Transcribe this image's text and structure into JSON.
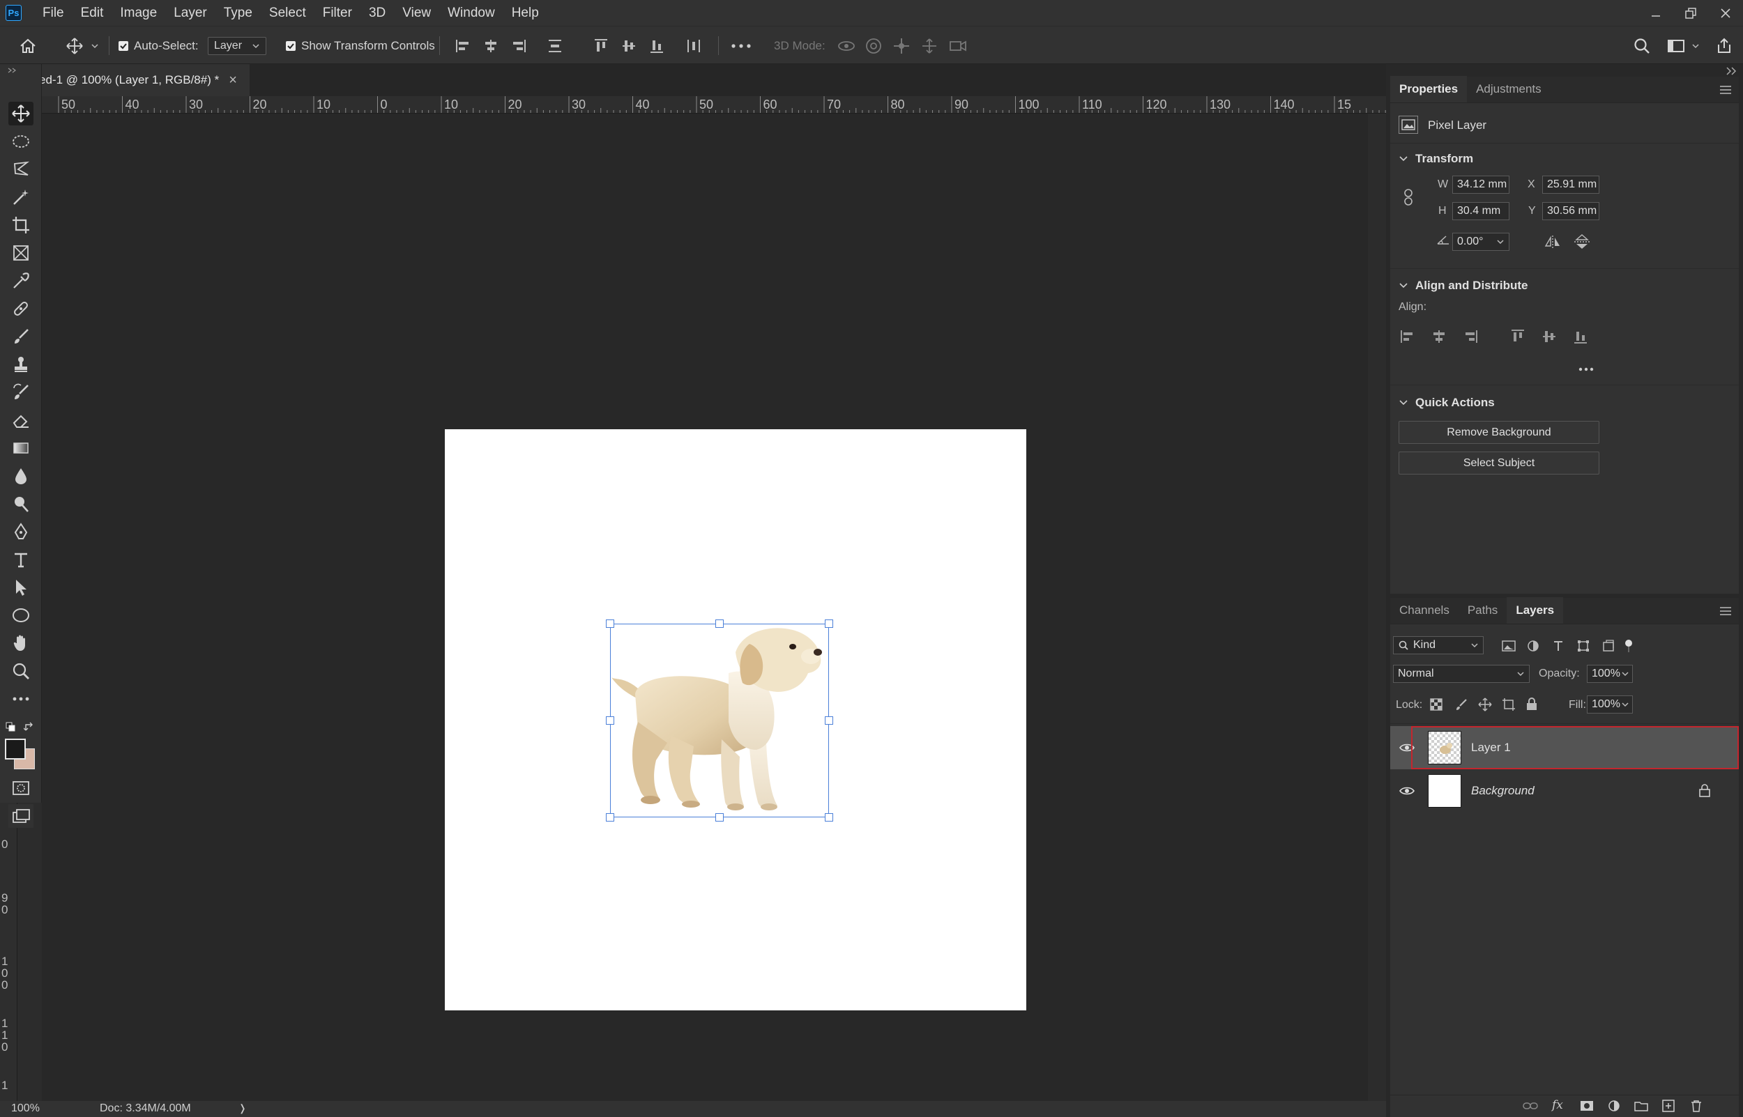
{
  "app": {
    "logo": "Ps"
  },
  "menu": [
    "File",
    "Edit",
    "Image",
    "Layer",
    "Type",
    "Select",
    "Filter",
    "3D",
    "View",
    "Window",
    "Help"
  ],
  "options": {
    "auto_select_label": "Auto-Select:",
    "auto_select_checked": true,
    "auto_select_target": "Layer",
    "show_transform_label": "Show Transform Controls",
    "show_transform_checked": true,
    "mode_3d_label": "3D Mode:"
  },
  "document_tab": {
    "title": "ed-1 @ 100% (Layer 1, RGB/8#) *",
    "close": "×"
  },
  "ruler": {
    "top": [
      "50",
      "40",
      "30",
      "20",
      "10",
      "0",
      "10",
      "20",
      "30",
      "40",
      "50",
      "60",
      "70",
      "80",
      "90",
      "100",
      "110",
      "120",
      "130",
      "140",
      "15"
    ],
    "left": [
      "0",
      "9",
      "0",
      "1",
      "0",
      "0",
      "1",
      "1",
      "0",
      "1"
    ]
  },
  "status": {
    "zoom": "100%",
    "doc": "Doc: 3.34M/4.00M",
    "arrow": "❭"
  },
  "properties": {
    "tabs": [
      "Properties",
      "Adjustments"
    ],
    "active_tab": "Properties",
    "type": "Pixel Layer",
    "transform": {
      "title": "Transform",
      "w_label": "W",
      "w": "34.12 mm",
      "h_label": "H",
      "h": "30.4 mm",
      "x_label": "X",
      "x": "25.91 mm",
      "y_label": "Y",
      "y": "30.56 mm",
      "angle": "0.00°"
    },
    "align": {
      "title": "Align and Distribute",
      "label": "Align:"
    },
    "quick_actions": {
      "title": "Quick Actions",
      "buttons": [
        "Remove Background",
        "Select Subject"
      ]
    }
  },
  "layers_panel": {
    "tabs": [
      "Channels",
      "Paths",
      "Layers"
    ],
    "active_tab": "Layers",
    "filter": "Kind",
    "blend_mode": "Normal",
    "opacity_label": "Opacity:",
    "opacity": "100%",
    "lock_label": "Lock:",
    "fill_label": "Fill:",
    "fill": "100%",
    "layers": [
      {
        "name": "Layer 1",
        "selected": true,
        "visible": true,
        "locked": false
      },
      {
        "name": "Background",
        "selected": false,
        "visible": true,
        "locked": true
      }
    ]
  },
  "colors": {
    "accent_selection": "#c4262e",
    "transform_handles": "#4a7fd8",
    "foreground_swatch": "#1a1a1a",
    "background_swatch": "#d8b8a8"
  }
}
